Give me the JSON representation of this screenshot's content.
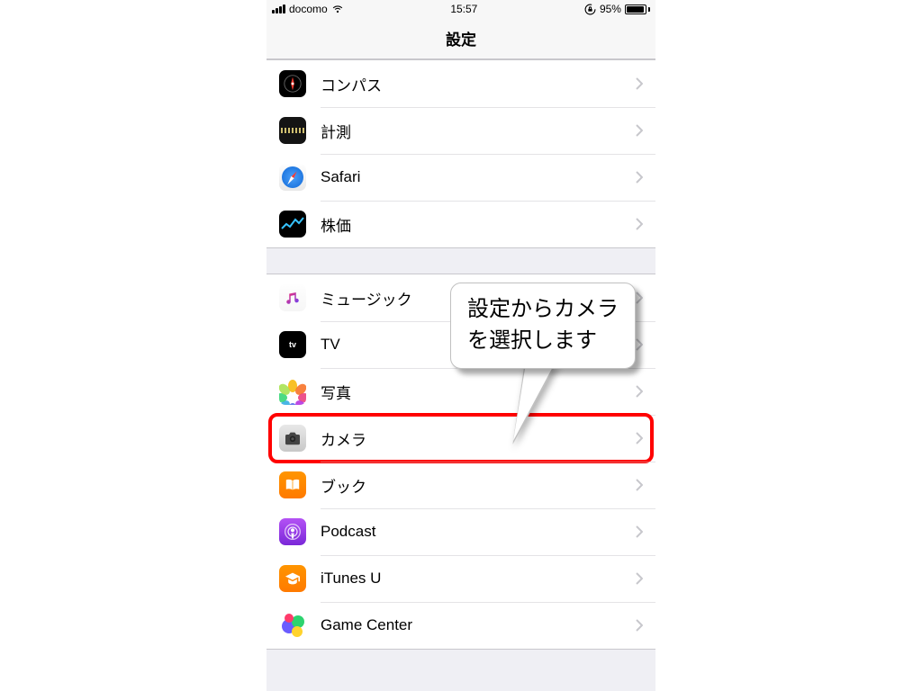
{
  "status": {
    "carrier": "docomo",
    "time": "15:57",
    "battery_pct": "95%"
  },
  "header": {
    "title": "設定"
  },
  "groups": [
    {
      "items": [
        {
          "key": "compass",
          "label": "コンパス"
        },
        {
          "key": "measure",
          "label": "計測"
        },
        {
          "key": "safari",
          "label": "Safari"
        },
        {
          "key": "stocks",
          "label": "株価"
        }
      ]
    },
    {
      "items": [
        {
          "key": "music",
          "label": "ミュージック"
        },
        {
          "key": "tv",
          "label": "TV"
        },
        {
          "key": "photos",
          "label": "写真"
        },
        {
          "key": "camera",
          "label": "カメラ",
          "highlighted": true
        },
        {
          "key": "books",
          "label": "ブック"
        },
        {
          "key": "podcast",
          "label": "Podcast"
        },
        {
          "key": "itunesu",
          "label": "iTunes U"
        },
        {
          "key": "gamecenter",
          "label": "Game Center"
        }
      ]
    }
  ],
  "callout": {
    "text": "設定からカメラ\nを選択します"
  },
  "battery_fill_pct": 95
}
